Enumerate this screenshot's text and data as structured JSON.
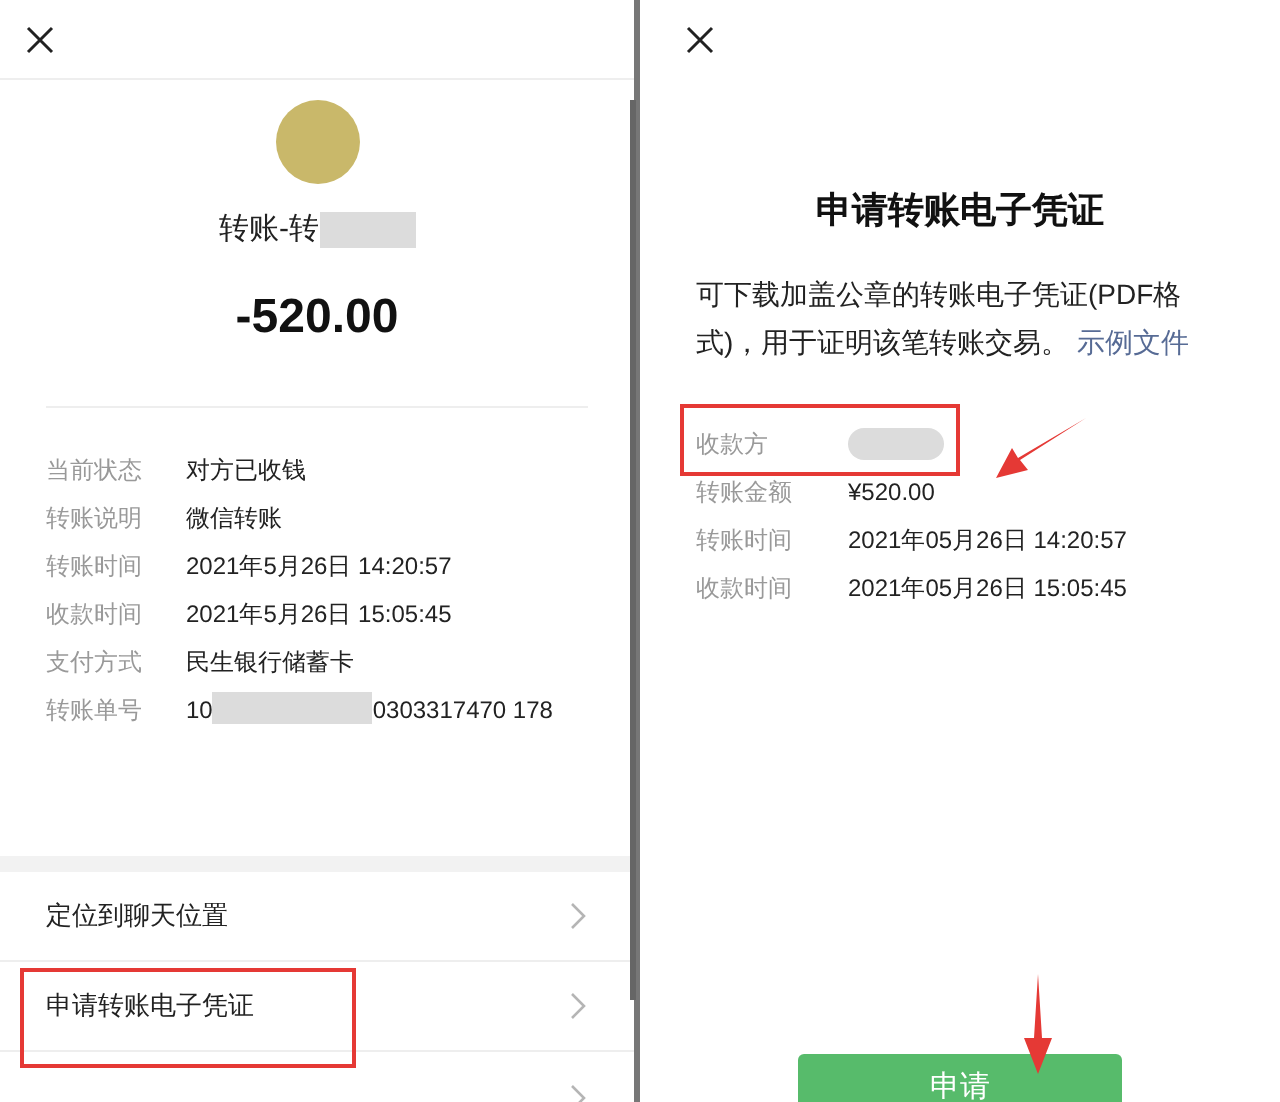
{
  "left_panel": {
    "title": "转账-转",
    "amount": "-520.00",
    "details": [
      {
        "label": "当前状态",
        "value": "对方已收钱"
      },
      {
        "label": "转账说明",
        "value": "微信转账"
      },
      {
        "label": "转账时间",
        "value": "2021年5月26日 14:20:57"
      },
      {
        "label": "收款时间",
        "value": "2021年5月26日 15:05:45"
      },
      {
        "label": "支付方式",
        "value": "民生银行储蓄卡"
      },
      {
        "label": "转账单号",
        "value": "10",
        "value_end": "0303317470 178"
      }
    ],
    "menu": [
      {
        "label": "定位到聊天位置",
        "highlighted": false
      },
      {
        "label": "申请转账电子凭证",
        "highlighted": true
      }
    ]
  },
  "right_panel": {
    "title": "申请转账电子凭证",
    "description": "可下载加盖公章的转账电子凭证(PDF格式)，用于证明该笔转账交易。",
    "link": "示例文件",
    "details": [
      {
        "label": "收款方",
        "highlighted": true
      },
      {
        "label": "转账金额",
        "value": "¥520.00",
        "highlighted": false
      },
      {
        "label": "转账时间",
        "value": "2021年05月26日 14:20:57",
        "highlighted": false
      },
      {
        "label": "收款时间",
        "value": "2021年05月26日 15:05:45",
        "highlighted": false
      }
    ],
    "button": "申请"
  }
}
